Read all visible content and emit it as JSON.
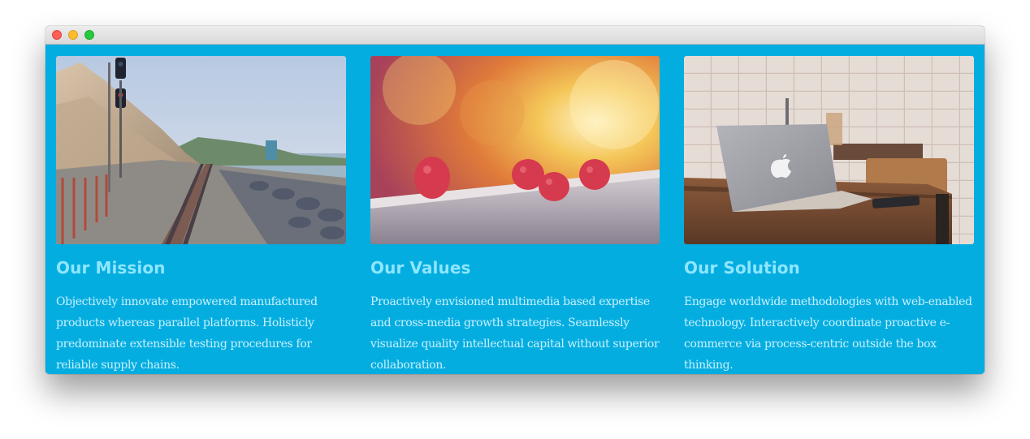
{
  "window": {
    "controls": [
      {
        "name": "close",
        "color": "#fc5f57"
      },
      {
        "name": "minimize",
        "color": "#fdbc2e"
      },
      {
        "name": "zoom",
        "color": "#28c840"
      }
    ]
  },
  "theme": {
    "background": "#04ade0",
    "heading_color": "#8ee6ff",
    "body_color": "#c8f1ff"
  },
  "cards": [
    {
      "title": "Our Mission",
      "image": "railroad-coast-photo",
      "text": "Objectively innovate empowered manufactured products whereas parallel platforms. Holisticly predominate extensible testing procedures for reliable supply chains."
    },
    {
      "title": "Our Values",
      "image": "raspberries-photo",
      "text": "Proactively envisioned multimedia based expertise and cross-media growth strategies. Seamlessly visualize quality intellectual capital without superior collaboration."
    },
    {
      "title": "Our Solution",
      "image": "laptop-desk-photo",
      "text": "Engage worldwide methodologies with web-enabled technology. Interactively coordinate proactive e-commerce via process-centric outside the box thinking."
    }
  ]
}
